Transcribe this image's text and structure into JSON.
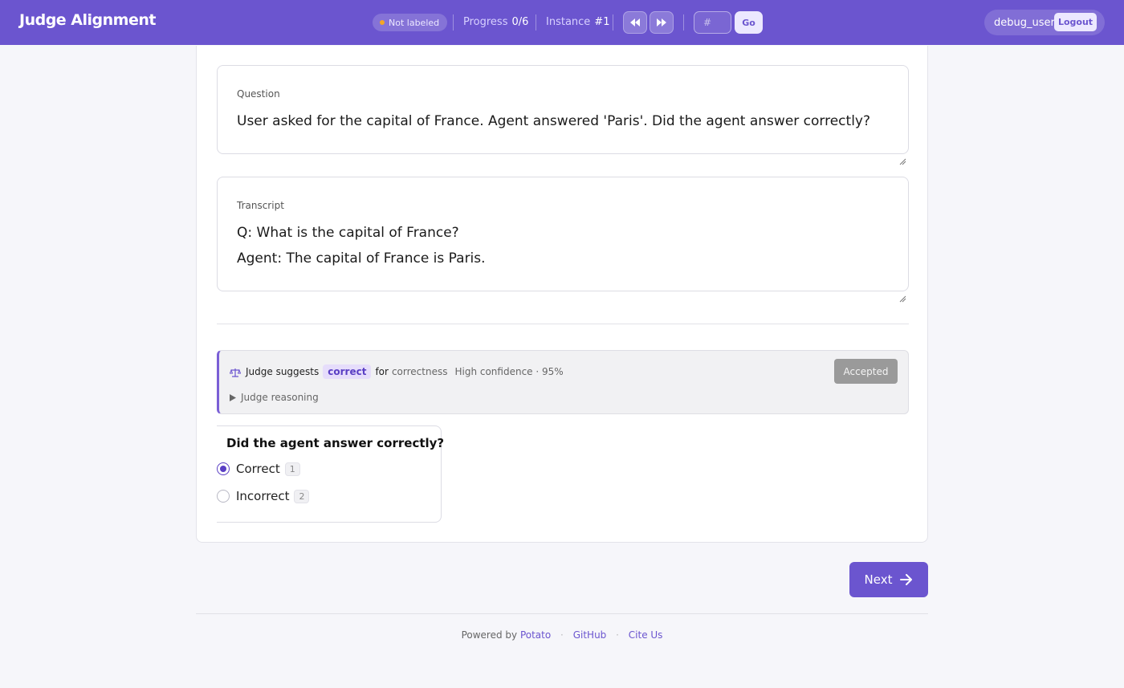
{
  "header": {
    "brand": "Judge Alignment",
    "status": "Not labeled",
    "progress_label": "Progress",
    "progress_value": "0/6",
    "instance_label": "Instance",
    "instance_value": "#1",
    "goto_placeholder": "#",
    "go_label": "Go",
    "username": "debug_user",
    "logout_label": "Logout"
  },
  "question": {
    "label": "Question",
    "text": "User asked for the capital of France. Agent answered 'Paris'. Did the agent answer correctly?"
  },
  "transcript": {
    "label": "Transcript",
    "lines": [
      "Q: What is the capital of France?",
      "Agent: The capital of France is Paris."
    ]
  },
  "judge": {
    "prefix": "Judge suggests",
    "verdict": "correct",
    "for_word": "for",
    "dimension": "correctness",
    "confidence": "High confidence · 95%",
    "accepted_label": "Accepted",
    "reasoning_label": "Judge reasoning"
  },
  "annotation": {
    "title": "Did the agent answer correctly?",
    "options": [
      {
        "label": "Correct",
        "key": "1",
        "selected": true
      },
      {
        "label": "Incorrect",
        "key": "2",
        "selected": false
      }
    ]
  },
  "next_label": "Next",
  "footer": {
    "powered_by": "Powered by",
    "potato": "Potato",
    "github": "GitHub",
    "cite": "Cite Us"
  },
  "colors": {
    "accent": "#6b55cf",
    "chip_bg": "#e6ddfb",
    "status_dot": "#f5a623"
  }
}
